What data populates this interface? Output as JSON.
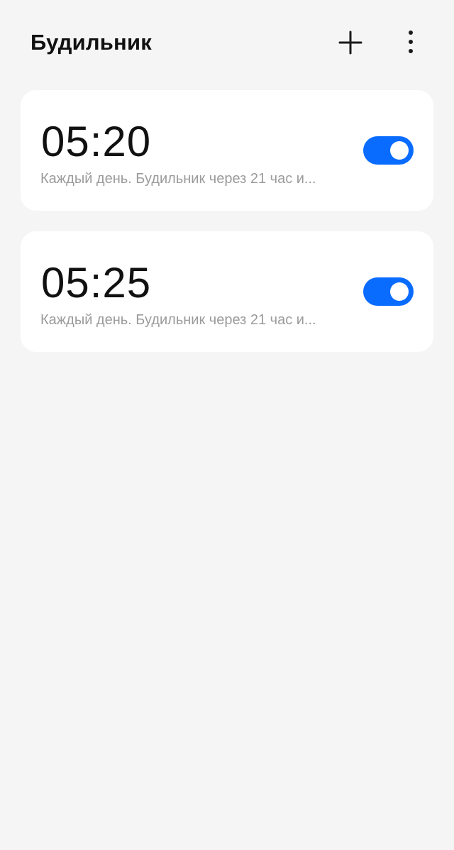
{
  "header": {
    "title": "Будильник",
    "add_icon": "plus-icon",
    "menu_icon": "more-vertical-icon"
  },
  "colors": {
    "background": "#f5f5f5",
    "card": "#ffffff",
    "accent": "#0a6cff",
    "secondary_text": "#9b9b9b"
  },
  "alarms": [
    {
      "time": "05:20",
      "description": "Каждый день. Будильник через 21 час и...",
      "enabled": true
    },
    {
      "time": "05:25",
      "description": "Каждый день. Будильник через 21 час и...",
      "enabled": true
    }
  ]
}
